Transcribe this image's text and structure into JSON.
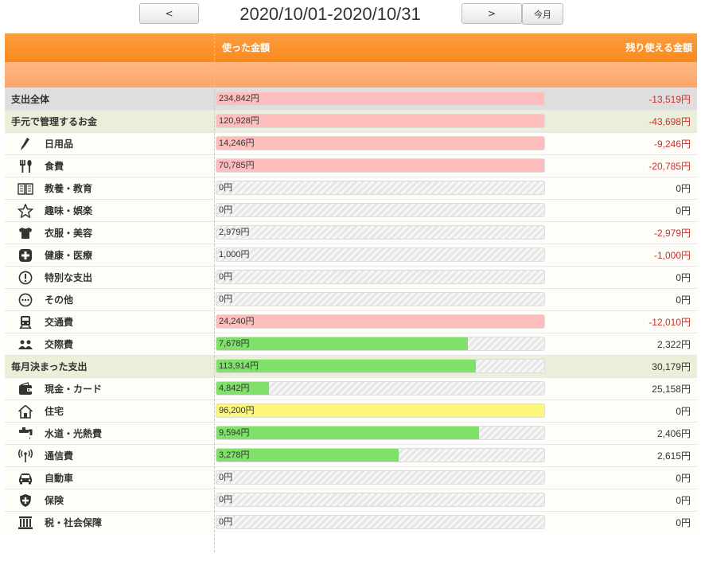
{
  "nav": {
    "prev_label": "<",
    "next_label": ">",
    "today_label": "今月",
    "period": "2020/10/01-2020/10/31"
  },
  "header": {
    "spent": "使った金額",
    "remaining": "残り使える金額"
  },
  "colors": {
    "header": "#f98a1d",
    "over": "#ffbdbd",
    "within": "#7fe06a",
    "exact": "#fcf67c",
    "negative": "#c9302c"
  },
  "rows": [
    {
      "kind": "total",
      "icon": "",
      "label": "支出全体",
      "spent": "234,842円",
      "remaining": "-13,519円",
      "fill": 1.0,
      "color": "red",
      "negative": true
    },
    {
      "kind": "group",
      "icon": "",
      "label": "手元で管理するお金",
      "spent": "120,928円",
      "remaining": "-43,698円",
      "fill": 1.0,
      "color": "red",
      "negative": true
    },
    {
      "kind": "item",
      "icon": "brush-icon",
      "label": "日用品",
      "spent": "14,246円",
      "remaining": "-9,246円",
      "fill": 1.0,
      "color": "red",
      "negative": true
    },
    {
      "kind": "item",
      "icon": "fork-spoon-icon",
      "label": "食費",
      "spent": "70,785円",
      "remaining": "-20,785円",
      "fill": 1.0,
      "color": "red",
      "negative": true
    },
    {
      "kind": "item",
      "icon": "book-icon",
      "label": "教養・教育",
      "spent": "0円",
      "remaining": "0円",
      "fill": 0,
      "color": "none",
      "negative": false
    },
    {
      "kind": "item",
      "icon": "star-icon",
      "label": "趣味・娯楽",
      "spent": "0円",
      "remaining": "0円",
      "fill": 0,
      "color": "none",
      "negative": false
    },
    {
      "kind": "item",
      "icon": "shirt-icon",
      "label": "衣服・美容",
      "spent": "2,979円",
      "remaining": "-2,979円",
      "fill": 0,
      "color": "none",
      "negative": true
    },
    {
      "kind": "item",
      "icon": "medical-cross-icon",
      "label": "健康・医療",
      "spent": "1,000円",
      "remaining": "-1,000円",
      "fill": 0,
      "color": "none",
      "negative": true
    },
    {
      "kind": "item",
      "icon": "exclamation-icon",
      "label": "特別な支出",
      "spent": "0円",
      "remaining": "0円",
      "fill": 0,
      "color": "none",
      "negative": false
    },
    {
      "kind": "item",
      "icon": "more-dots-icon",
      "label": "その他",
      "spent": "0円",
      "remaining": "0円",
      "fill": 0,
      "color": "none",
      "negative": false
    },
    {
      "kind": "item",
      "icon": "train-icon",
      "label": "交通費",
      "spent": "24,240円",
      "remaining": "-12,010円",
      "fill": 1.0,
      "color": "red",
      "negative": true
    },
    {
      "kind": "item",
      "icon": "people-icon",
      "label": "交際費",
      "spent": "7,678円",
      "remaining": "2,322円",
      "fill": 0.768,
      "color": "green",
      "negative": false
    },
    {
      "kind": "group",
      "icon": "",
      "label": "毎月決まった支出",
      "spent": "113,914円",
      "remaining": "30,179円",
      "fill": 0.791,
      "color": "green",
      "negative": false
    },
    {
      "kind": "item",
      "icon": "wallet-icon",
      "label": "現金・カード",
      "spent": "4,842円",
      "remaining": "25,158円",
      "fill": 0.161,
      "color": "green",
      "negative": false
    },
    {
      "kind": "item",
      "icon": "house-icon",
      "label": "住宅",
      "spent": "96,200円",
      "remaining": "0円",
      "fill": 1.0,
      "color": "yellow",
      "negative": false
    },
    {
      "kind": "item",
      "icon": "faucet-icon",
      "label": "水道・光熱費",
      "spent": "9,594円",
      "remaining": "2,406円",
      "fill": 0.8,
      "color": "green",
      "negative": false
    },
    {
      "kind": "item",
      "icon": "antenna-icon",
      "label": "通信費",
      "spent": "3,278円",
      "remaining": "2,615円",
      "fill": 0.556,
      "color": "green",
      "negative": false
    },
    {
      "kind": "item",
      "icon": "car-icon",
      "label": "自動車",
      "spent": "0円",
      "remaining": "0円",
      "fill": 0,
      "color": "none",
      "negative": false
    },
    {
      "kind": "item",
      "icon": "shield-plus-icon",
      "label": "保険",
      "spent": "0円",
      "remaining": "0円",
      "fill": 0,
      "color": "none",
      "negative": false
    },
    {
      "kind": "item",
      "icon": "government-icon",
      "label": "税・社会保障",
      "spent": "0円",
      "remaining": "0円",
      "fill": 0,
      "color": "none",
      "negative": false
    }
  ]
}
